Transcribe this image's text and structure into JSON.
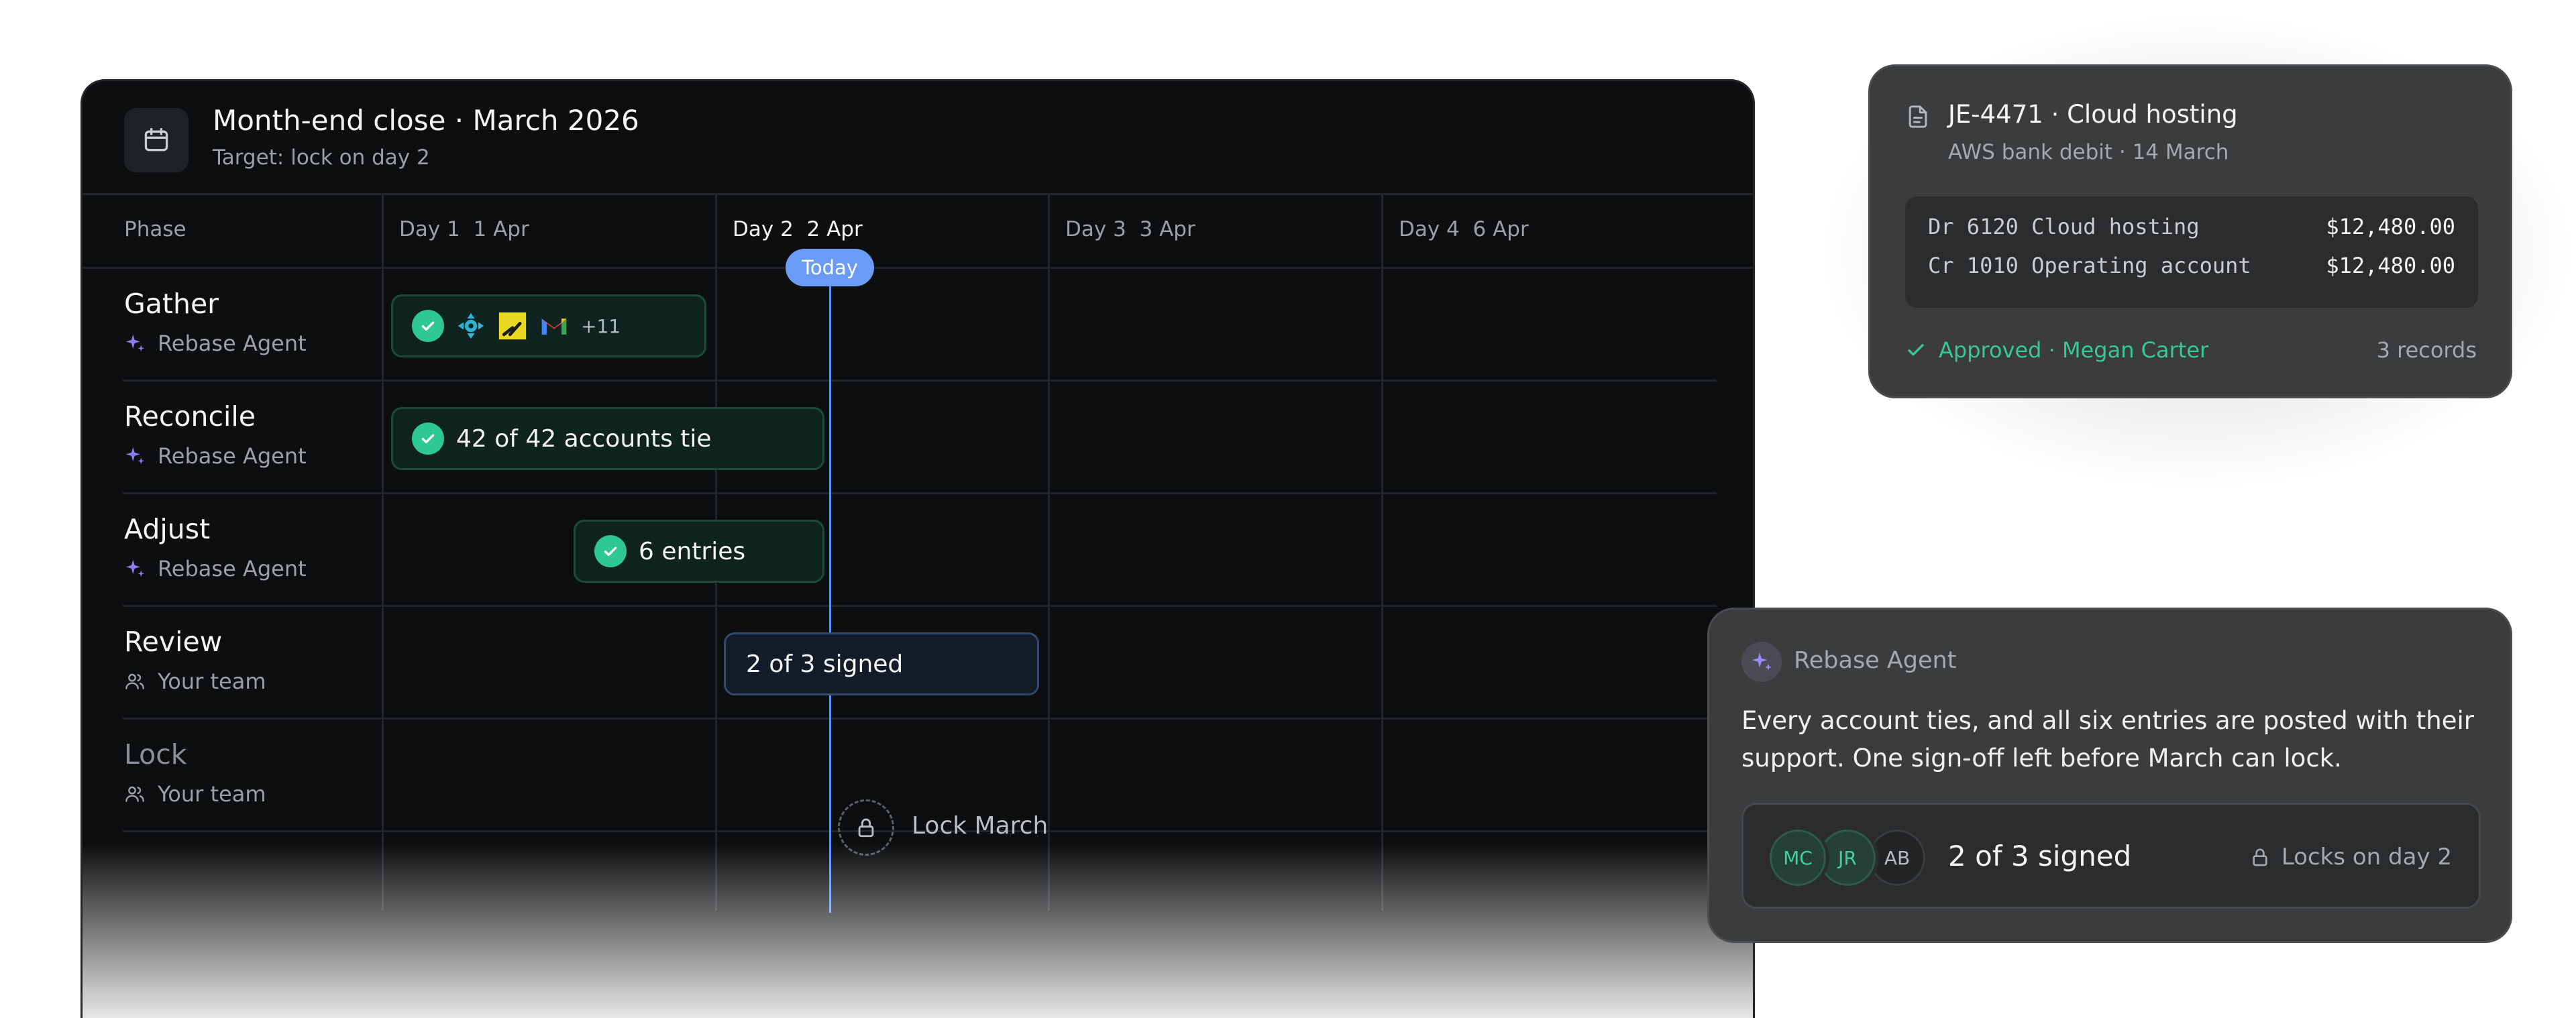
{
  "panel": {
    "title": "Month-end close · March 2026",
    "subtitle": "Target: lock on day 2"
  },
  "columns": {
    "phase": "Phase",
    "days": [
      {
        "label": "Day 1  1 Apr"
      },
      {
        "label": "Day 2  2 Apr",
        "active": true
      },
      {
        "label": "Day 3  3 Apr"
      },
      {
        "label": "Day 4  6 Apr"
      }
    ]
  },
  "today_label": "Today",
  "phases": [
    {
      "name": "Gather",
      "owner": "Rebase Agent",
      "owner_icon": "sparkle-icon"
    },
    {
      "name": "Reconcile",
      "owner": "Rebase Agent",
      "owner_icon": "sparkle-icon"
    },
    {
      "name": "Adjust",
      "owner": "Rebase Agent",
      "owner_icon": "sparkle-icon"
    },
    {
      "name": "Review",
      "owner": "Your team",
      "owner_icon": "team-icon"
    },
    {
      "name": "Lock",
      "owner": "Your team",
      "owner_icon": "team-icon"
    }
  ],
  "bars": {
    "gather": {
      "more": "+11",
      "sources": [
        "connector-icon",
        "sheets-icon",
        "gmail-icon"
      ]
    },
    "reconcile": {
      "label": "42 of 42 accounts tie"
    },
    "adjust": {
      "label": "6 entries"
    },
    "review": {
      "label": "2 of 3 signed"
    },
    "lock": {
      "label": "Lock March"
    }
  },
  "journal_entry": {
    "title": "JE-4471 · Cloud hosting",
    "subtitle": "AWS bank debit · 14 March",
    "lines": [
      {
        "account": "Dr 6120 Cloud hosting",
        "amount": "$12,480.00"
      },
      {
        "account": "Cr 1010 Operating account",
        "amount": "$12,480.00"
      }
    ],
    "approval": "Approved · Megan Carter",
    "records": "3 records"
  },
  "agent": {
    "name": "Rebase Agent",
    "message": "Every account ties, and all six entries are posted with their support. One sign-off left before March can lock.",
    "signers": [
      {
        "initials": "MC",
        "signed": true
      },
      {
        "initials": "JR",
        "signed": true
      },
      {
        "initials": "AB",
        "signed": false
      }
    ],
    "signed_label": "2 of 3 signed",
    "lock_label": "Locks on day 2"
  },
  "colors": {
    "accent_blue": "#6a9bf6",
    "success_green": "#2ec796",
    "panel_bg": "#0c0e10",
    "card_bg": "#3a3c3e"
  }
}
